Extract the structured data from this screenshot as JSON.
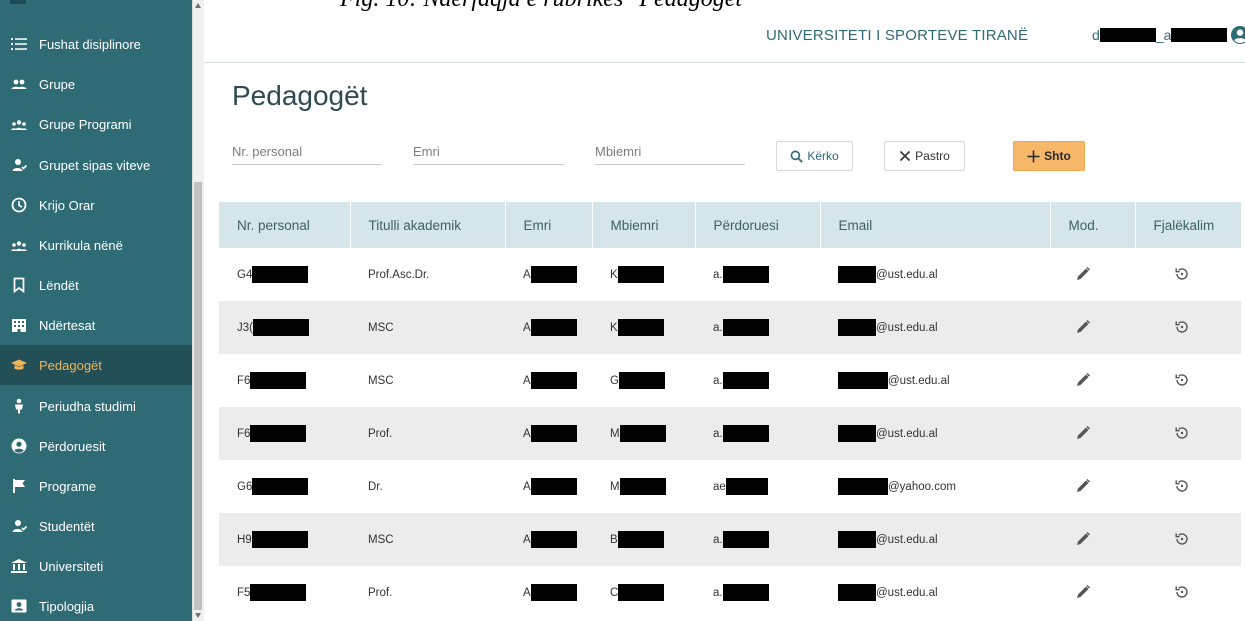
{
  "caption": "Fig. 10: Ndërfaqja e rubrikës \"Pedagogët\"",
  "sidebar": {
    "items": [
      {
        "label": "Fushat disiplinore",
        "icon": "list-icon"
      },
      {
        "label": "Grupe",
        "icon": "group-icon"
      },
      {
        "label": "Grupe Programi",
        "icon": "group-program-icon"
      },
      {
        "label": "Grupet sipas viteve",
        "icon": "user-year-icon"
      },
      {
        "label": "Krijo Orar",
        "icon": "clock-icon"
      },
      {
        "label": "Kurrikula nënë",
        "icon": "group-program-icon"
      },
      {
        "label": "Lëndët",
        "icon": "bookmark-icon"
      },
      {
        "label": "Ndërtesat",
        "icon": "building-icon"
      },
      {
        "label": "Pedagogët",
        "icon": "graduation-cap-icon",
        "active": true
      },
      {
        "label": "Periudha studimi",
        "icon": "person-icon"
      },
      {
        "label": "Përdoruesit",
        "icon": "user-circle-icon"
      },
      {
        "label": "Programe",
        "icon": "flag-icon"
      },
      {
        "label": "Studentët",
        "icon": "user-year-icon"
      },
      {
        "label": "Universiteti",
        "icon": "university-icon"
      },
      {
        "label": "Tipologjia",
        "icon": "id-card-icon"
      }
    ]
  },
  "header": {
    "university": "UNIVERSITETI I SPORTEVE TIRANË",
    "user_prefix": "d",
    "user_mid": "_a"
  },
  "page": {
    "title": "Pedagogët"
  },
  "filters": {
    "nr_personal_placeholder": "Nr. personal",
    "emri_placeholder": "Emri",
    "mbiemri_placeholder": "Mbiemri"
  },
  "buttons": {
    "search": "Kërko",
    "clear": "Pastro",
    "add": "Shto"
  },
  "table": {
    "columns": [
      "Nr. personal",
      "Titulli akademik",
      "Emri",
      "Mbiemri",
      "Përdoruesi",
      "Email",
      "Mod.",
      "Fjalëkalim"
    ],
    "rows": [
      {
        "nr": "G4",
        "title": "Prof.Asc.Dr.",
        "emri": "A",
        "mbiemri": "K",
        "user": "a.",
        "email": "@ust.edu.al"
      },
      {
        "nr": "J3(",
        "title": "MSC",
        "emri": "A",
        "mbiemri": "K",
        "user": "a.",
        "email": "@ust.edu.al"
      },
      {
        "nr": "F6",
        "title": "MSC",
        "emri": "A",
        "mbiemri": "G",
        "user": "a.",
        "email": "@ust.edu.al"
      },
      {
        "nr": "F6",
        "title": "Prof.",
        "emri": "A",
        "mbiemri": "M",
        "user": "a.",
        "email": "@ust.edu.al"
      },
      {
        "nr": "G6",
        "title": "Dr.",
        "emri": "A",
        "mbiemri": "M",
        "user": "ae",
        "email": "@yahoo.com"
      },
      {
        "nr": "H9",
        "title": "MSC",
        "emri": "A",
        "mbiemri": "B",
        "user": "a.",
        "email": "@ust.edu.al"
      },
      {
        "nr": "F5",
        "title": "Prof.",
        "emri": "A",
        "mbiemri": "C",
        "user": "a.",
        "email": "@ust.edu.al"
      }
    ]
  },
  "colors": {
    "sidebar": "#2f6b75",
    "sidebar_active": "#234f57",
    "active_text": "#f0b45a",
    "header_bg": "#d4e6ea",
    "add_button": "#f7b768"
  }
}
